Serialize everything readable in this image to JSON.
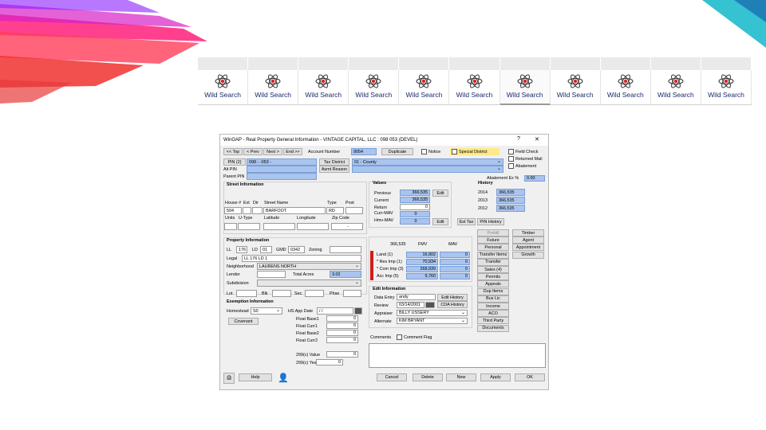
{
  "colors": {
    "accent_blue": "#a9c4ee",
    "special_district": "#ffe98a",
    "red_marker": "#d01c1c"
  },
  "search_tabs": [
    "Wild Search",
    "Wild Search",
    "Wild Search",
    "Wild Search",
    "Wild Search",
    "Wild Search",
    "Wild Search",
    "Wild Search",
    "Wild Search",
    "Wild Search",
    "Wild Search"
  ],
  "window": {
    "title": "WinGAP - Real Property General Information - VINTAGE CAPITAL, LLC : 098   053        (DEVEL)",
    "help_glyph": "?",
    "close_glyph": "✕"
  },
  "nav": {
    "top": "<< Top",
    "prev": "< Prev",
    "next": "Next >",
    "end": "End >>"
  },
  "account": {
    "label": "Account Number",
    "value": "9054",
    "duplicate": "Duplicate",
    "notice": "Notice",
    "special_district": "Special District"
  },
  "flags": {
    "field_check": "Field Check",
    "returned_mail": "Returned Mail",
    "abatement": "Abatement"
  },
  "pin": {
    "button": "PIN (2)",
    "value": "098 -  -053 -",
    "alt_label": "Alt PIN",
    "parent_label": "Parent PIN"
  },
  "tax": {
    "district_button": "Tax District",
    "district_value": "01 - County",
    "asmt_button": "Asmt Reason"
  },
  "abatement": {
    "label": "Abatement Ex %",
    "value": "0.00"
  },
  "street": {
    "header": "Street Information",
    "cols": [
      "House #",
      "Ext",
      "Dir",
      "Street Name",
      "Type",
      "Post"
    ],
    "house": "504",
    "name": "BARFOOT",
    "type": "RD",
    "cols2": [
      "Units",
      "U-Type",
      "Latitude",
      "Longitude",
      "Zip Code"
    ],
    "zip": "-"
  },
  "values": {
    "header": "Values",
    "rows": [
      {
        "label": "Previous",
        "value": "366,535"
      },
      {
        "label": "Current",
        "value": "366,535"
      },
      {
        "label": "Return",
        "value": "0"
      },
      {
        "label": "Curr-MAV",
        "value": "0"
      },
      {
        "label": "Hmv-MAV",
        "value": "0"
      }
    ],
    "edit": "Edit",
    "edit2": "Edit",
    "est_tax": "Est Tax",
    "pin_history": "PIN History"
  },
  "history": {
    "header": "History",
    "rows": [
      {
        "year": "2014",
        "value": "366,535"
      },
      {
        "year": "2013",
        "value": "366,535"
      },
      {
        "year": "2012",
        "value": "366,535"
      }
    ]
  },
  "property": {
    "header": "Property Information",
    "ll_label": "LL",
    "ll": "176",
    "ld_label": "LD",
    "ld": "01",
    "gmd_label": "GMD",
    "gmd": "0342",
    "zoning_label": "Zoning",
    "legal_label": "Legal",
    "legal": "LL 176 LD 1",
    "neighborhood_label": "Neighborhood",
    "neighborhood": "LAURENS NORTH",
    "lender_label": "Lender",
    "total_acres_label": "Total Acres",
    "total_acres": "3.02",
    "subdivision_label": "Subdivision",
    "lot_label": "Lot",
    "blk_label": "Blk",
    "sec_label": "Sec",
    "phse_label": "Phse"
  },
  "exemption": {
    "header": "Exemption Information",
    "homestead_label": "Homestead",
    "homestead": "S0",
    "covenant": "Covenant",
    "hs_app_label": "HS App Date",
    "hs_app": "/  /",
    "float_rows": [
      {
        "label": "Float Base1",
        "value": "0"
      },
      {
        "label": "Float Curr1",
        "value": "0"
      },
      {
        "label": "Float Base2",
        "value": "0"
      },
      {
        "label": "Float Curr2",
        "value": "0"
      }
    ],
    "v299c_label": "299(c) Value",
    "v299c": "0",
    "y299c_label": "299(c) Year",
    "y299c": "0"
  },
  "fmv": {
    "total": "366,535",
    "fmv_label": "FMV",
    "mav_label": "MAV",
    "rows": [
      {
        "label": "Land (1)",
        "fmv": "16,902",
        "mav": "0"
      },
      {
        "label": "* Res Imp (1)",
        "fmv": "70,934",
        "mav": "0"
      },
      {
        "label": "* Com Imp (3)",
        "fmv": "268,939",
        "mav": "0"
      },
      {
        "label": "Acc Imp (5)",
        "fmv": "9,760",
        "mav": "0"
      }
    ]
  },
  "edit_info": {
    "header": "Edit Information",
    "data_entry_label": "Data Entry",
    "data_entry": "andy",
    "review_label": "Review",
    "review": "03/14/2001",
    "appraiser_label": "Appraiser",
    "appraiser": "BILLY USSERY",
    "alternate_label": "Alternate",
    "alternate": "KIM BRYANT",
    "edit_history": "Edit History",
    "cda_history": "CDA History"
  },
  "comments": {
    "label": "Comments",
    "comment_flag": "Comment Flag"
  },
  "side_buttons": [
    "Prebill",
    "Future",
    "Personal",
    "Transfer Items",
    "Transfer",
    "Sales (4)",
    "Permits",
    "Appeals",
    "Dup Items",
    "Bus Lic",
    "Income",
    "ACO",
    "Third Party",
    "Documents"
  ],
  "far_buttons": [
    "Timber",
    "Agent",
    "Appointment",
    "Growth"
  ],
  "footer": {
    "help": "Help",
    "cancel": "Cancel",
    "delete": "Delete",
    "new": "New",
    "apply": "Apply",
    "ok": "OK"
  }
}
